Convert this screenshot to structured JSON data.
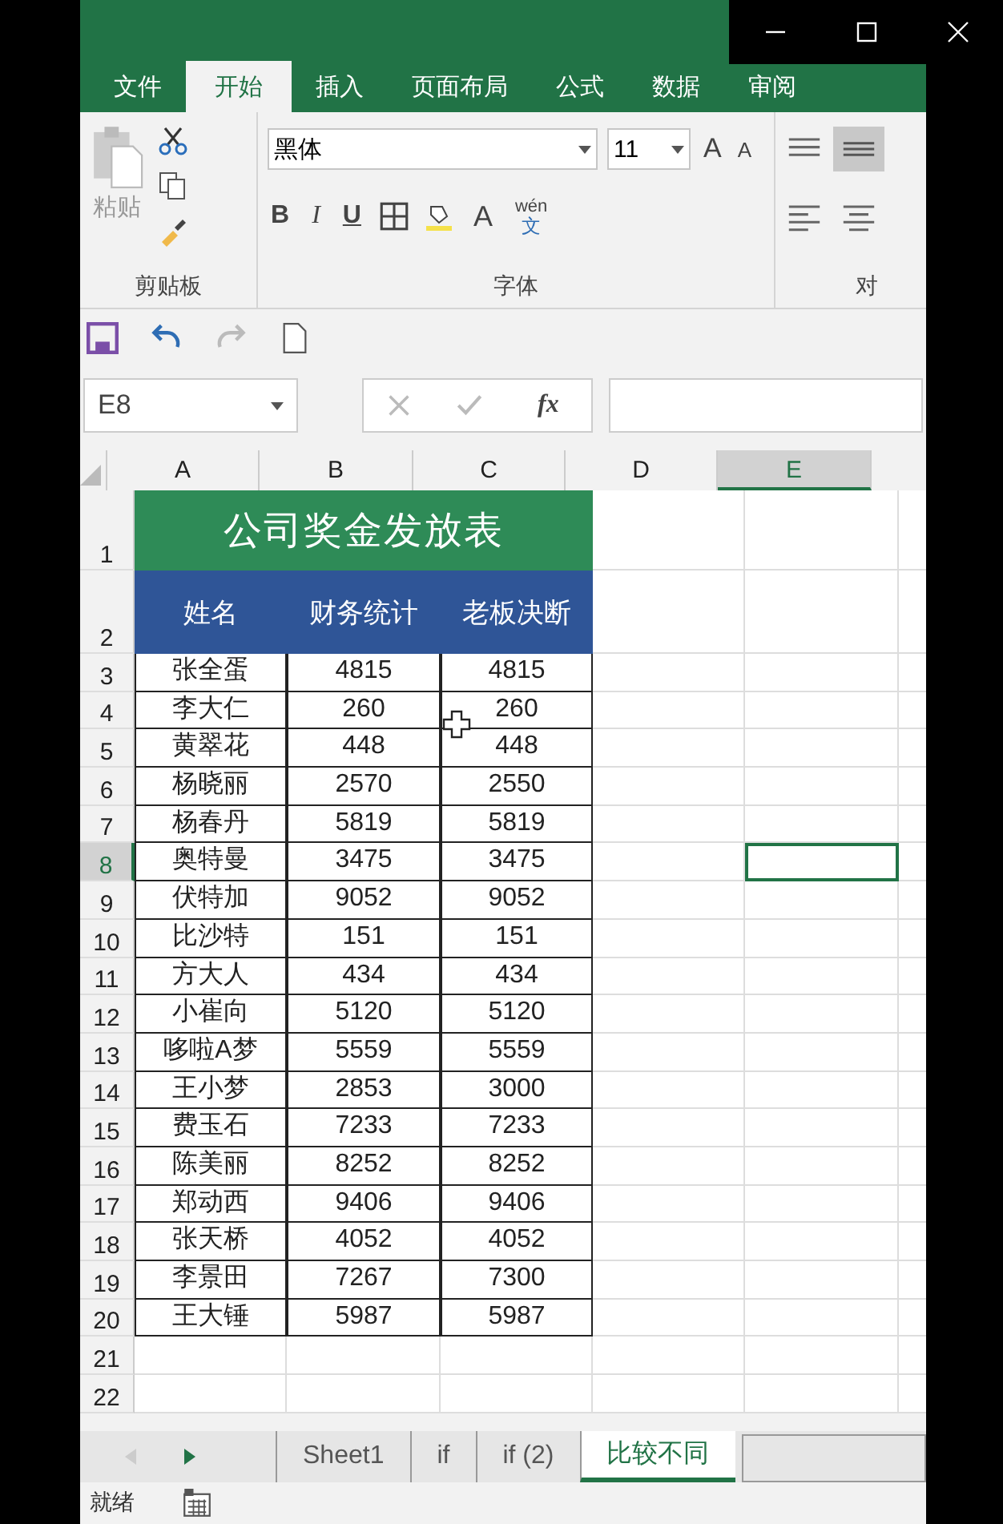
{
  "ribbon_tabs": [
    {
      "label": "文件",
      "selected": false
    },
    {
      "label": "开始",
      "selected": true
    },
    {
      "label": "插入",
      "selected": false
    },
    {
      "label": "页面布局",
      "selected": false
    },
    {
      "label": "公式",
      "selected": false
    },
    {
      "label": "数据",
      "selected": false
    },
    {
      "label": "审阅",
      "selected": false
    }
  ],
  "clipboard": {
    "paste_label": "粘贴",
    "group_label": "剪贴板"
  },
  "font": {
    "font_name": "黑体",
    "font_size": "11",
    "grow": "A",
    "shrink": "A",
    "bold": "B",
    "italic": "I",
    "underline": "U",
    "font_color": "A",
    "phonetic_top": "wén",
    "phonetic_bottom": "文",
    "group_label": "字体"
  },
  "alignment": {
    "group_label": "对"
  },
  "name_box": "E8",
  "fx": "fx",
  "columns": [
    {
      "label": "A",
      "selected": false
    },
    {
      "label": "B",
      "selected": false
    },
    {
      "label": "C",
      "selected": false
    },
    {
      "label": "D",
      "selected": false
    },
    {
      "label": "E",
      "selected": true
    }
  ],
  "title": "公司奖金发放表",
  "headers": [
    "姓名",
    "财务统计",
    "老板决断"
  ],
  "rows": [
    {
      "label": "1",
      "selected": false
    },
    {
      "label": "2",
      "selected": false
    },
    {
      "label": "3",
      "selected": false
    },
    {
      "label": "4",
      "selected": false
    },
    {
      "label": "5",
      "selected": false
    },
    {
      "label": "6",
      "selected": false
    },
    {
      "label": "7",
      "selected": false
    },
    {
      "label": "8",
      "selected": true
    },
    {
      "label": "9",
      "selected": false
    },
    {
      "label": "10",
      "selected": false
    },
    {
      "label": "11",
      "selected": false
    },
    {
      "label": "12",
      "selected": false
    },
    {
      "label": "13",
      "selected": false
    },
    {
      "label": "14",
      "selected": false
    },
    {
      "label": "15",
      "selected": false
    },
    {
      "label": "16",
      "selected": false
    },
    {
      "label": "17",
      "selected": false
    },
    {
      "label": "18",
      "selected": false
    },
    {
      "label": "19",
      "selected": false
    },
    {
      "label": "20",
      "selected": false
    },
    {
      "label": "21",
      "selected": false
    },
    {
      "label": "22",
      "selected": false
    }
  ],
  "records": [
    [
      "张全蛋",
      "4815",
      "4815"
    ],
    [
      "李大仁",
      "260",
      "260"
    ],
    [
      "黄翠花",
      "448",
      "448"
    ],
    [
      "杨晓丽",
      "2570",
      "2550"
    ],
    [
      "杨春丹",
      "5819",
      "5819"
    ],
    [
      "奥特曼",
      "3475",
      "3475"
    ],
    [
      "伏特加",
      "9052",
      "9052"
    ],
    [
      "比沙特",
      "151",
      "151"
    ],
    [
      "方大人",
      "434",
      "434"
    ],
    [
      "小崔向",
      "5120",
      "5120"
    ],
    [
      "哆啦A梦",
      "5559",
      "5559"
    ],
    [
      "王小梦",
      "2853",
      "3000"
    ],
    [
      "费玉石",
      "7233",
      "7233"
    ],
    [
      "陈美丽",
      "8252",
      "8252"
    ],
    [
      "郑动西",
      "9406",
      "9406"
    ],
    [
      "张天桥",
      "4052",
      "4052"
    ],
    [
      "李景田",
      "7267",
      "7300"
    ],
    [
      "王大锤",
      "5987",
      "5987"
    ]
  ],
  "sheet_tabs": [
    {
      "label": "Sheet1",
      "selected": false
    },
    {
      "label": "if",
      "selected": false
    },
    {
      "label": "if (2)",
      "selected": false
    },
    {
      "label": "比较不同",
      "selected": true
    }
  ],
  "status": "就绪"
}
